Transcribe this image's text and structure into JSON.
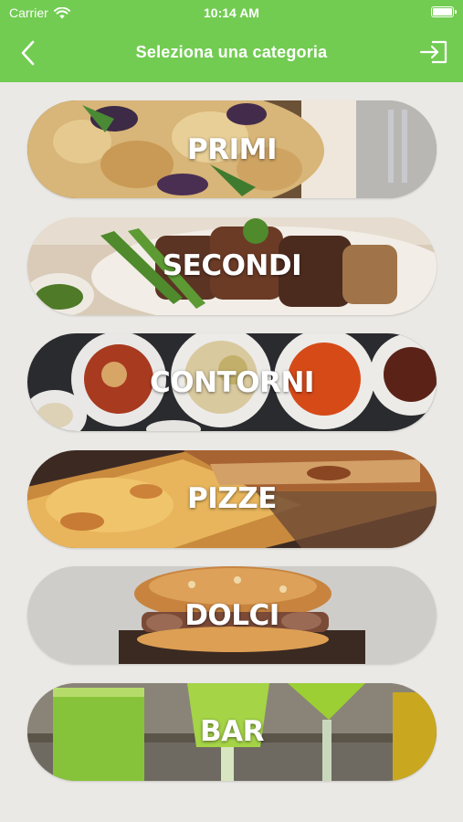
{
  "status_bar": {
    "carrier": "Carrier",
    "time": "10:14 AM"
  },
  "nav": {
    "title": "Seleziona una categoria",
    "back_icon": "chevron-left-icon",
    "logout_icon": "logout-icon"
  },
  "colors": {
    "header": "#72cc52",
    "background": "#ebe9e5"
  },
  "categories": [
    {
      "label": "PRIMI",
      "image": "pasta"
    },
    {
      "label": "SECONDI",
      "image": "grilled-meat"
    },
    {
      "label": "CONTORNI",
      "image": "side-dishes"
    },
    {
      "label": "PIZZE",
      "image": "pizza"
    },
    {
      "label": "DOLCI",
      "image": "pastry"
    },
    {
      "label": "BAR",
      "image": "green-drinks"
    }
  ]
}
